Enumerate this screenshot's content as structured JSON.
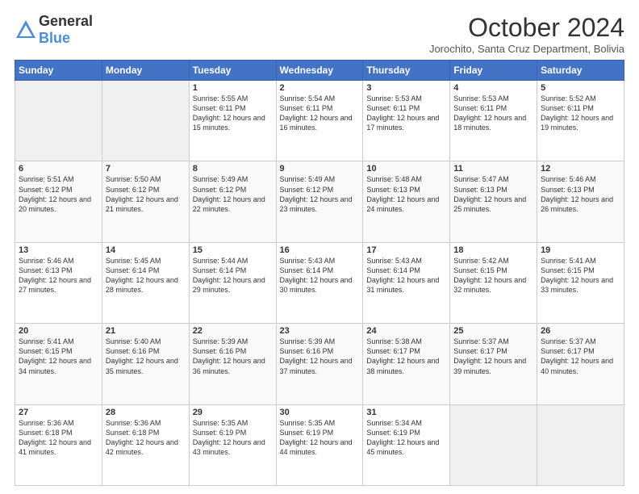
{
  "logo": {
    "general": "General",
    "blue": "Blue"
  },
  "title": "October 2024",
  "subtitle": "Jorochito, Santa Cruz Department, Bolivia",
  "days_header": [
    "Sunday",
    "Monday",
    "Tuesday",
    "Wednesday",
    "Thursday",
    "Friday",
    "Saturday"
  ],
  "weeks": [
    [
      {
        "day": "",
        "empty": true
      },
      {
        "day": "",
        "empty": true
      },
      {
        "day": "1",
        "sunrise": "5:55 AM",
        "sunset": "6:11 PM",
        "daylight": "12 hours and 15 minutes."
      },
      {
        "day": "2",
        "sunrise": "5:54 AM",
        "sunset": "6:11 PM",
        "daylight": "12 hours and 16 minutes."
      },
      {
        "day": "3",
        "sunrise": "5:53 AM",
        "sunset": "6:11 PM",
        "daylight": "12 hours and 17 minutes."
      },
      {
        "day": "4",
        "sunrise": "5:53 AM",
        "sunset": "6:11 PM",
        "daylight": "12 hours and 18 minutes."
      },
      {
        "day": "5",
        "sunrise": "5:52 AM",
        "sunset": "6:11 PM",
        "daylight": "12 hours and 19 minutes."
      }
    ],
    [
      {
        "day": "6",
        "sunrise": "5:51 AM",
        "sunset": "6:12 PM",
        "daylight": "12 hours and 20 minutes."
      },
      {
        "day": "7",
        "sunrise": "5:50 AM",
        "sunset": "6:12 PM",
        "daylight": "12 hours and 21 minutes."
      },
      {
        "day": "8",
        "sunrise": "5:49 AM",
        "sunset": "6:12 PM",
        "daylight": "12 hours and 22 minutes."
      },
      {
        "day": "9",
        "sunrise": "5:49 AM",
        "sunset": "6:12 PM",
        "daylight": "12 hours and 23 minutes."
      },
      {
        "day": "10",
        "sunrise": "5:48 AM",
        "sunset": "6:13 PM",
        "daylight": "12 hours and 24 minutes."
      },
      {
        "day": "11",
        "sunrise": "5:47 AM",
        "sunset": "6:13 PM",
        "daylight": "12 hours and 25 minutes."
      },
      {
        "day": "12",
        "sunrise": "5:46 AM",
        "sunset": "6:13 PM",
        "daylight": "12 hours and 26 minutes."
      }
    ],
    [
      {
        "day": "13",
        "sunrise": "5:46 AM",
        "sunset": "6:13 PM",
        "daylight": "12 hours and 27 minutes."
      },
      {
        "day": "14",
        "sunrise": "5:45 AM",
        "sunset": "6:14 PM",
        "daylight": "12 hours and 28 minutes."
      },
      {
        "day": "15",
        "sunrise": "5:44 AM",
        "sunset": "6:14 PM",
        "daylight": "12 hours and 29 minutes."
      },
      {
        "day": "16",
        "sunrise": "5:43 AM",
        "sunset": "6:14 PM",
        "daylight": "12 hours and 30 minutes."
      },
      {
        "day": "17",
        "sunrise": "5:43 AM",
        "sunset": "6:14 PM",
        "daylight": "12 hours and 31 minutes."
      },
      {
        "day": "18",
        "sunrise": "5:42 AM",
        "sunset": "6:15 PM",
        "daylight": "12 hours and 32 minutes."
      },
      {
        "day": "19",
        "sunrise": "5:41 AM",
        "sunset": "6:15 PM",
        "daylight": "12 hours and 33 minutes."
      }
    ],
    [
      {
        "day": "20",
        "sunrise": "5:41 AM",
        "sunset": "6:15 PM",
        "daylight": "12 hours and 34 minutes."
      },
      {
        "day": "21",
        "sunrise": "5:40 AM",
        "sunset": "6:16 PM",
        "daylight": "12 hours and 35 minutes."
      },
      {
        "day": "22",
        "sunrise": "5:39 AM",
        "sunset": "6:16 PM",
        "daylight": "12 hours and 36 minutes."
      },
      {
        "day": "23",
        "sunrise": "5:39 AM",
        "sunset": "6:16 PM",
        "daylight": "12 hours and 37 minutes."
      },
      {
        "day": "24",
        "sunrise": "5:38 AM",
        "sunset": "6:17 PM",
        "daylight": "12 hours and 38 minutes."
      },
      {
        "day": "25",
        "sunrise": "5:37 AM",
        "sunset": "6:17 PM",
        "daylight": "12 hours and 39 minutes."
      },
      {
        "day": "26",
        "sunrise": "5:37 AM",
        "sunset": "6:17 PM",
        "daylight": "12 hours and 40 minutes."
      }
    ],
    [
      {
        "day": "27",
        "sunrise": "5:36 AM",
        "sunset": "6:18 PM",
        "daylight": "12 hours and 41 minutes."
      },
      {
        "day": "28",
        "sunrise": "5:36 AM",
        "sunset": "6:18 PM",
        "daylight": "12 hours and 42 minutes."
      },
      {
        "day": "29",
        "sunrise": "5:35 AM",
        "sunset": "6:19 PM",
        "daylight": "12 hours and 43 minutes."
      },
      {
        "day": "30",
        "sunrise": "5:35 AM",
        "sunset": "6:19 PM",
        "daylight": "12 hours and 44 minutes."
      },
      {
        "day": "31",
        "sunrise": "5:34 AM",
        "sunset": "6:19 PM",
        "daylight": "12 hours and 45 minutes."
      },
      {
        "day": "",
        "empty": true
      },
      {
        "day": "",
        "empty": true
      }
    ]
  ],
  "labels": {
    "sunrise": "Sunrise: ",
    "sunset": "Sunset: ",
    "daylight": "Daylight: "
  }
}
